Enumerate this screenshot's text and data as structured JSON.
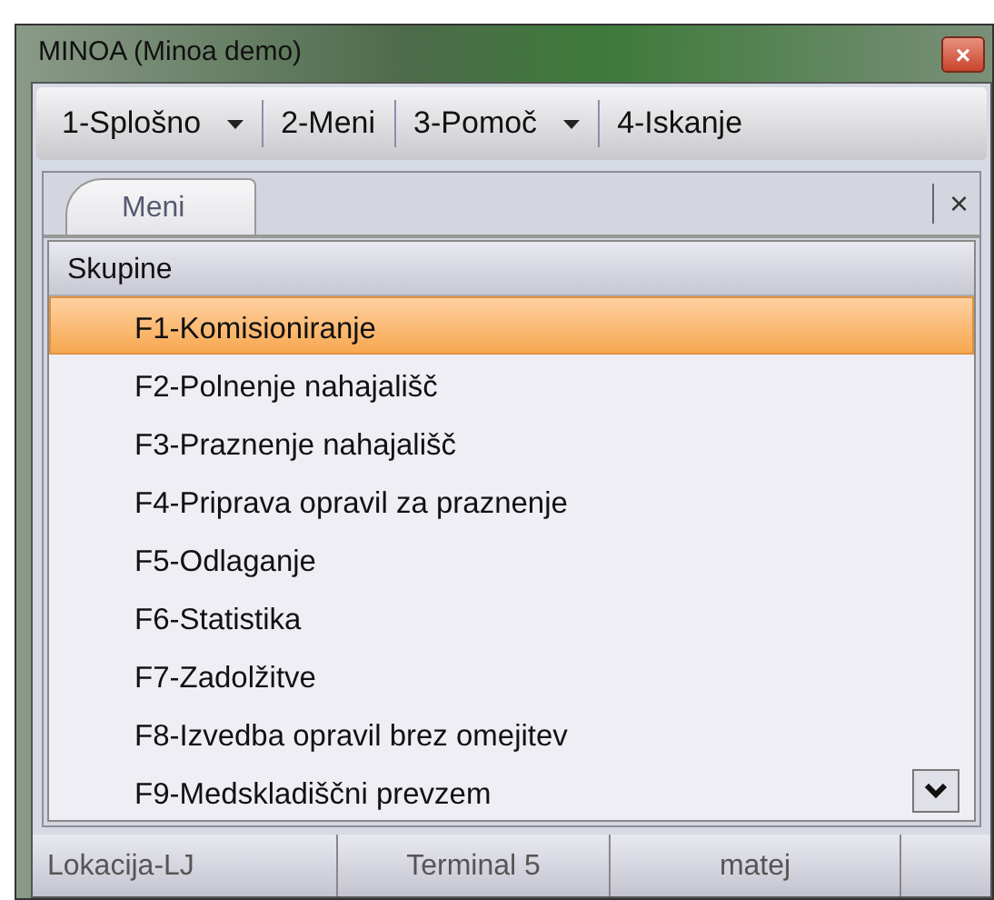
{
  "window": {
    "title": "MINOA (Minoa demo)",
    "close": "×"
  },
  "toolbar": [
    {
      "label": "1-Splošno",
      "dropdown": true
    },
    {
      "label": "2-Meni",
      "dropdown": false
    },
    {
      "label": "3-Pomoč",
      "dropdown": true
    },
    {
      "label": "4-Iskanje",
      "dropdown": false
    }
  ],
  "panel": {
    "tab": {
      "label": "Meni",
      "selected": true
    },
    "close": "×",
    "header": "Skupine",
    "items": [
      {
        "label": "F1-Komisioniranje",
        "selected": true
      },
      {
        "label": "F2-Polnenje nahajališč",
        "selected": false
      },
      {
        "label": "F3-Praznenje nahajališč",
        "selected": false
      },
      {
        "label": "F4-Priprava opravil za praznenje",
        "selected": false
      },
      {
        "label": "F5-Odlaganje",
        "selected": false
      },
      {
        "label": "F6-Statistika",
        "selected": false
      },
      {
        "label": "F7-Zadolžitve",
        "selected": false
      },
      {
        "label": "F8-Izvedba opravil brez omejitev",
        "selected": false
      },
      {
        "label": "F9-Medskladiščni prevzem",
        "selected": false
      }
    ]
  },
  "status_bar": [
    "Lokacija-LJ",
    "Terminal 5",
    "matej"
  ]
}
